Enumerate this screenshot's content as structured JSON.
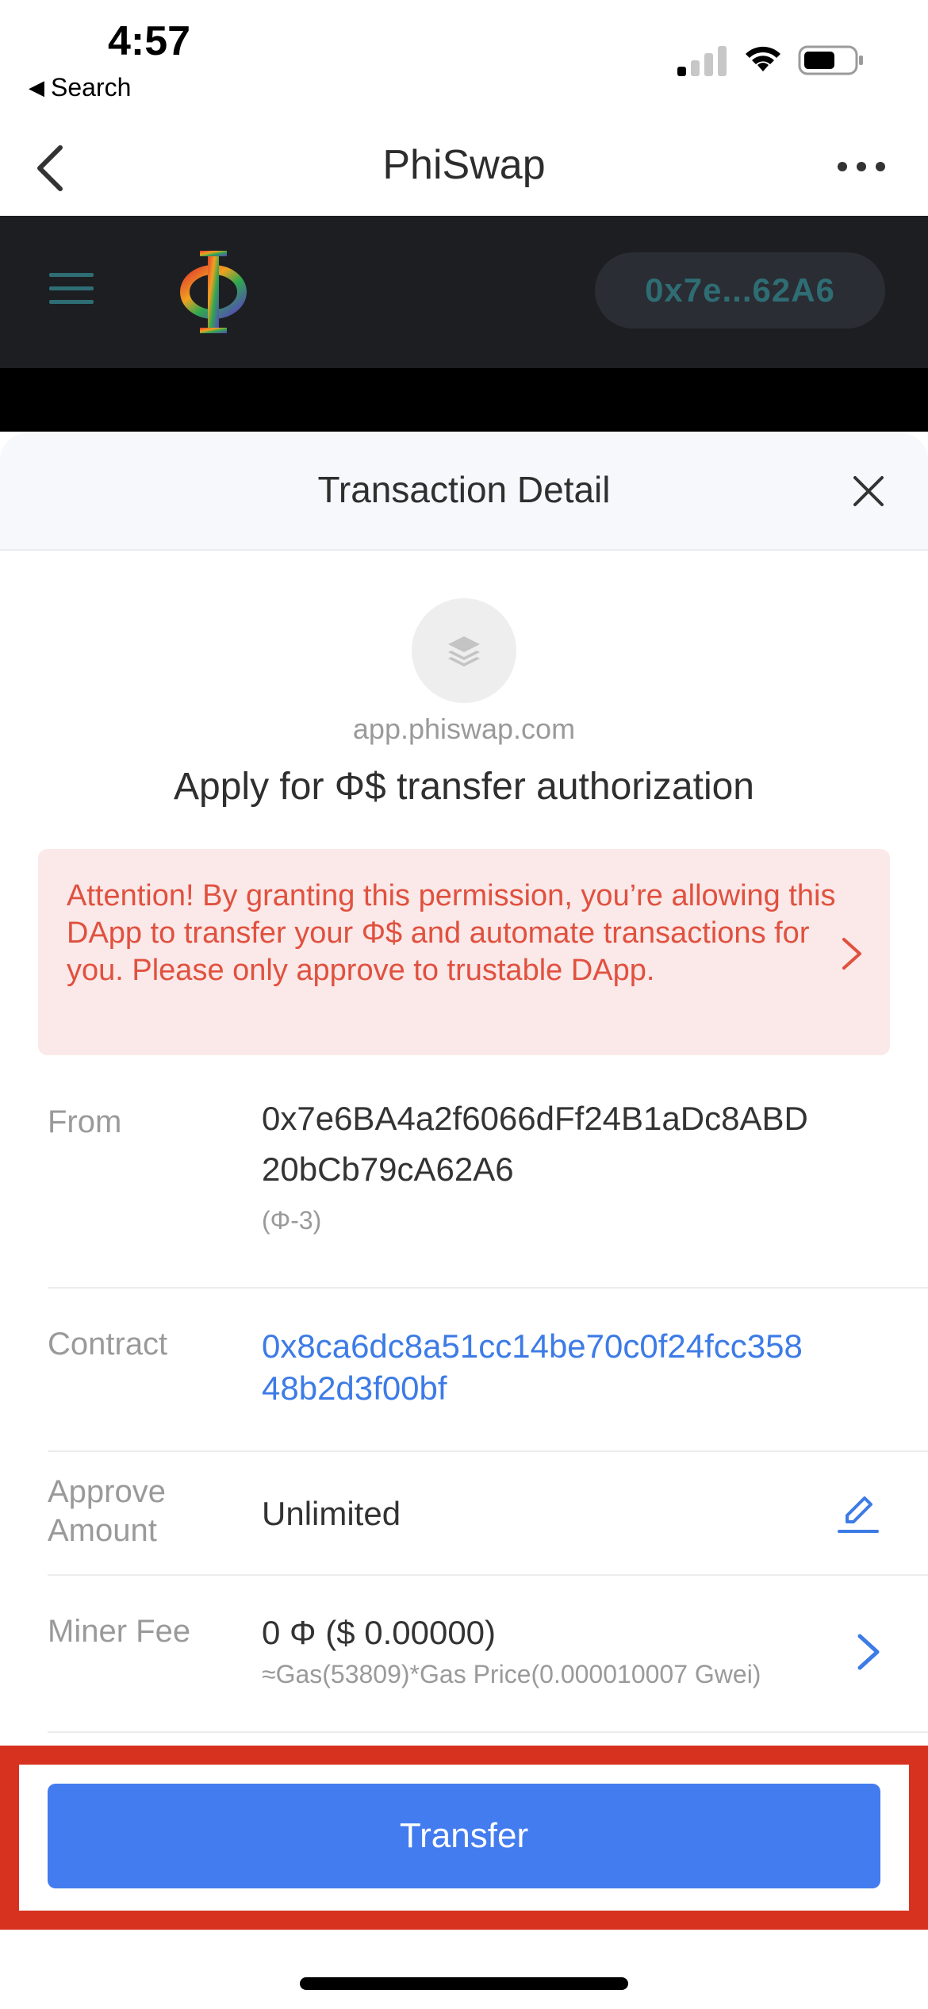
{
  "status_bar": {
    "time": "4:57",
    "back_app": "Search"
  },
  "nav": {
    "title": "PhiSwap"
  },
  "dapp": {
    "wallet_address": "0x7e...62A6",
    "colors": {
      "header_bg": "#1c1e22",
      "menu_icon": "#2f6d74"
    }
  },
  "sheet": {
    "title": "Transaction Detail",
    "site_domain": "app.phiswap.com",
    "request_title": "Apply for Φ$ transfer authorization",
    "warning": "Attention!  By granting this permission, you’re allowing this DApp to transfer your Φ$ and automate transactions for you. Please only approve to trustable DApp.",
    "rows": {
      "from": {
        "label": "From",
        "value_line1": "0x7e6BA4a2f6066dFf24B1aDc8ABD",
        "value_line2": "20bCb79cA62A6",
        "network": "(Φ-3)"
      },
      "contract": {
        "label": "Contract",
        "value_line1": "0x8ca6dc8a51cc14be70c0f24fcc358",
        "value_line2": "48b2d3f00bf"
      },
      "approve_amount": {
        "label_line1": "Approve",
        "label_line2": "Amount",
        "value": "Unlimited"
      },
      "miner_fee": {
        "label": "Miner Fee",
        "value": "0 Φ ($ 0.00000)",
        "detail": "≈Gas(53809)*Gas Price(0.000010007 Gwei)"
      }
    },
    "transfer_label": "Transfer"
  },
  "colors": {
    "accent": "#437cee",
    "warning_text": "#e0513f",
    "warning_bg": "#fbe8e8",
    "highlight_frame": "#d6321f"
  }
}
